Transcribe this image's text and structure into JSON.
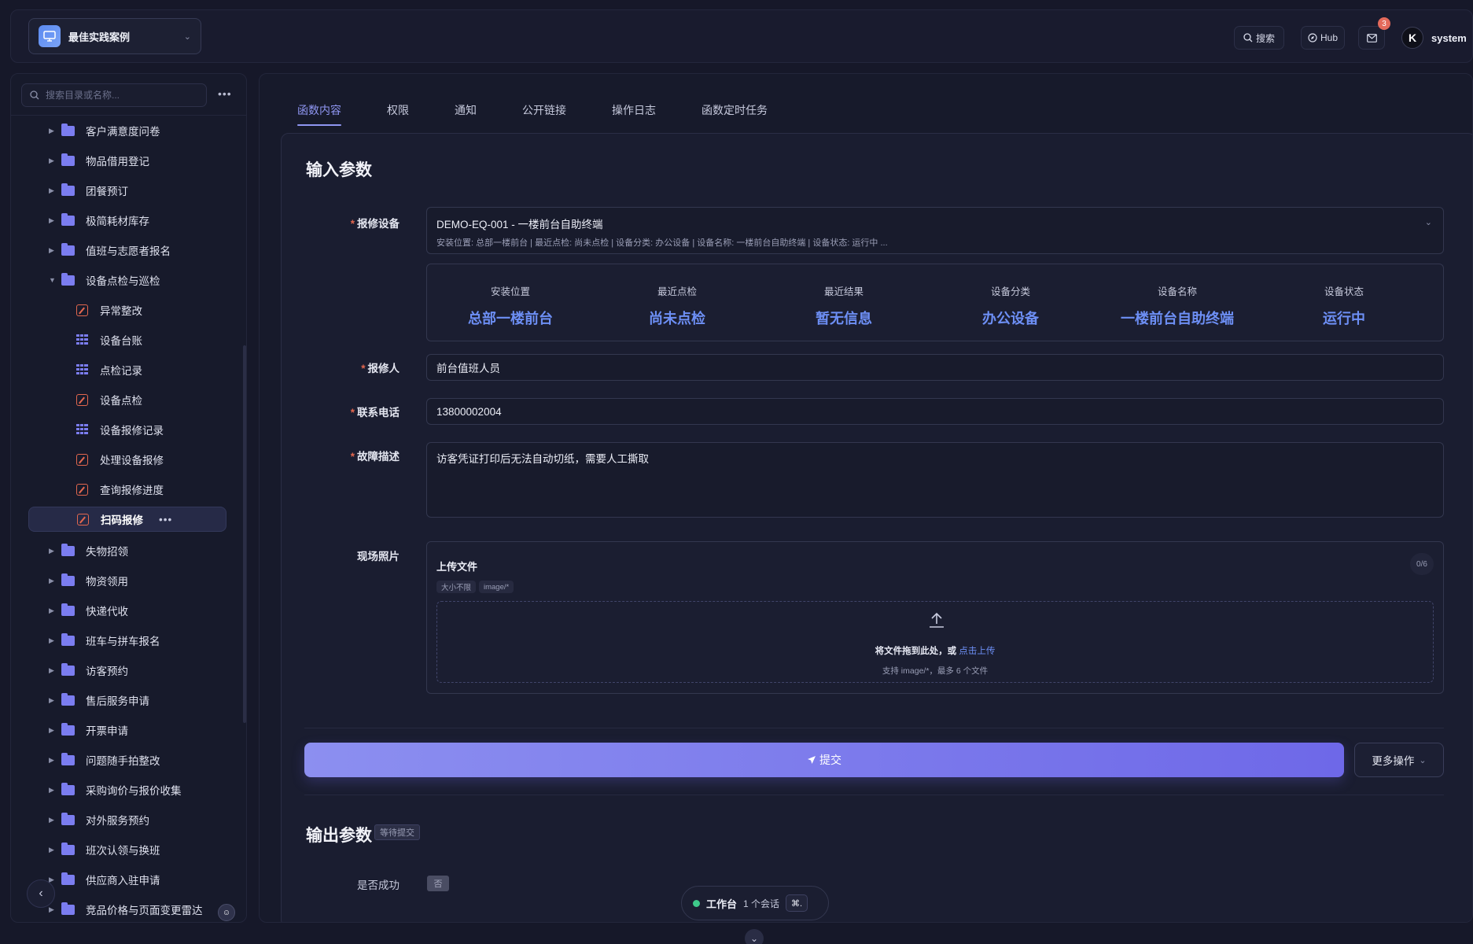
{
  "header": {
    "project_name": "最佳实践案例",
    "search_label": "搜索",
    "hub_label": "Hub",
    "mail_badge": "3",
    "user_initial": "K",
    "user_name": "system"
  },
  "sidebar": {
    "search_placeholder": "搜索目录或名称...",
    "more_label": "•••",
    "items": [
      {
        "label": "客户满意度问卷",
        "type": "folder"
      },
      {
        "label": "物品借用登记",
        "type": "folder"
      },
      {
        "label": "团餐预订",
        "type": "folder"
      },
      {
        "label": "极简耗材库存",
        "type": "folder"
      },
      {
        "label": "值班与志愿者报名",
        "type": "folder"
      },
      {
        "label": "设备点检与巡检",
        "type": "folder-open"
      },
      {
        "label": "异常整改",
        "type": "form"
      },
      {
        "label": "设备台账",
        "type": "table"
      },
      {
        "label": "点检记录",
        "type": "table"
      },
      {
        "label": "设备点检",
        "type": "form"
      },
      {
        "label": "设备报修记录",
        "type": "table"
      },
      {
        "label": "处理设备报修",
        "type": "form"
      },
      {
        "label": "查询报修进度",
        "type": "form"
      },
      {
        "label": "扫码报修",
        "type": "form-active"
      },
      {
        "label": "失物招领",
        "type": "folder"
      },
      {
        "label": "物资领用",
        "type": "folder"
      },
      {
        "label": "快递代收",
        "type": "folder"
      },
      {
        "label": "班车与拼车报名",
        "type": "folder"
      },
      {
        "label": "访客预约",
        "type": "folder"
      },
      {
        "label": "售后服务申请",
        "type": "folder"
      },
      {
        "label": "开票申请",
        "type": "folder"
      },
      {
        "label": "问题随手拍整改",
        "type": "folder"
      },
      {
        "label": "采购询价与报价收集",
        "type": "folder"
      },
      {
        "label": "对外服务预约",
        "type": "folder"
      },
      {
        "label": "班次认领与换班",
        "type": "folder"
      },
      {
        "label": "供应商入驻申请",
        "type": "folder"
      },
      {
        "label": "竞品价格与页面变更雷达",
        "type": "folder"
      }
    ]
  },
  "tabs": [
    "函数内容",
    "权限",
    "通知",
    "公开链接",
    "操作日志",
    "函数定时任务"
  ],
  "form": {
    "input_title": "输入参数",
    "device_label": "报修设备",
    "device_value": "DEMO-EQ-001 - 一楼前台自助终端",
    "device_sub": "安装位置: 总部一楼前台 | 最近点检: 尚未点检 | 设备分类: 办公设备 | 设备名称: 一楼前台自助终端 | 设备状态: 运行中 ...",
    "info": [
      {
        "k": "安装位置",
        "v": "总部一楼前台"
      },
      {
        "k": "最近点检",
        "v": "尚未点检"
      },
      {
        "k": "最近结果",
        "v": "暂无信息"
      },
      {
        "k": "设备分类",
        "v": "办公设备"
      },
      {
        "k": "设备名称",
        "v": "一楼前台自助终端"
      },
      {
        "k": "设备状态",
        "v": "运行中"
      }
    ],
    "reporter_label": "报修人",
    "reporter_value": "前台值班人员",
    "phone_label": "联系电话",
    "phone_value": "13800002004",
    "desc_label": "故障描述",
    "desc_value": "访客凭证打印后无法自动切纸，需要人工撕取",
    "photo_label": "现场照片",
    "upload_title": "上传文件",
    "upload_count": "0/6",
    "tag_size": "大小不限",
    "tag_type": "image/*",
    "drop_text": "将文件拖到此处，或",
    "drop_link": "点击上传",
    "drop_hint": "支持 image/*，最多 6 个文件",
    "submit_label": "提交",
    "more_label": "更多操作",
    "output_title": "输出参数",
    "output_status": "等待提交",
    "success_label": "是否成功",
    "success_value": "否"
  },
  "workbench": {
    "title": "工作台",
    "sessions": "1 个会话",
    "shortcut": "⌘."
  },
  "colors": {
    "accent": "#8f96f2",
    "value_blue": "#6d8ff5",
    "required": "#e2674f",
    "online": "#3ec98a"
  }
}
